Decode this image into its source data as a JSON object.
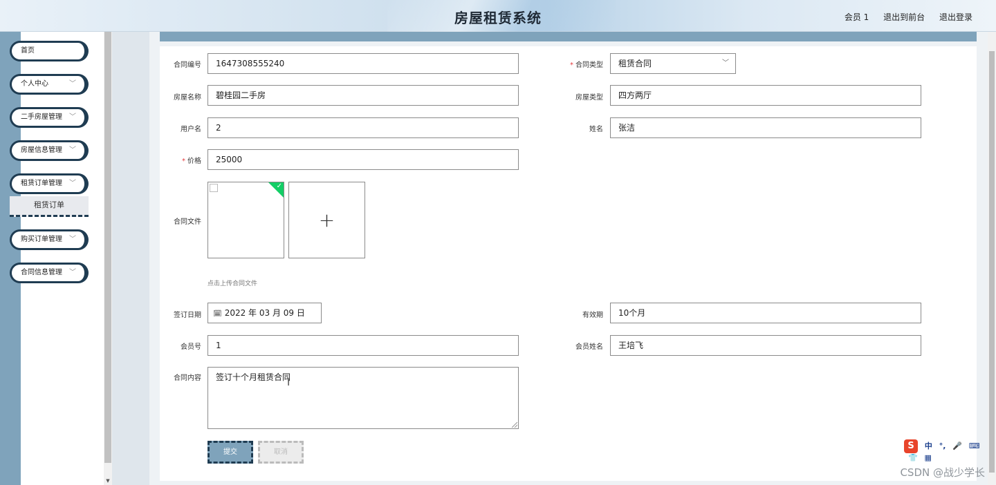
{
  "header": {
    "title": "房屋租赁系统",
    "nav": [
      "会员 1",
      "退出到前台",
      "退出登录"
    ]
  },
  "sidebar": {
    "items": [
      {
        "label": "首页",
        "has_chevron": false
      },
      {
        "label": "个人中心",
        "has_chevron": true
      },
      {
        "label": "二手房屋管理",
        "has_chevron": true
      },
      {
        "label": "房屋信息管理",
        "has_chevron": true
      },
      {
        "label": "租赁订单管理",
        "has_chevron": true
      },
      {
        "label": "购买订单管理",
        "has_chevron": true
      },
      {
        "label": "合同信息管理",
        "has_chevron": true
      }
    ],
    "submenu": {
      "label": "租赁订单"
    }
  },
  "form": {
    "contract_no": {
      "label": "合同编号",
      "value": "1647308555240"
    },
    "contract_type": {
      "label": "合同类型",
      "required": true,
      "value": "租赁合同"
    },
    "house_name": {
      "label": "房屋名称",
      "value": "碧桂园二手房"
    },
    "house_type": {
      "label": "房屋类型",
      "value": "四方两厅"
    },
    "username": {
      "label": "用户名",
      "value": "2"
    },
    "name": {
      "label": "姓名",
      "value": "张洁"
    },
    "price": {
      "label": "价格",
      "required": true,
      "value": "25000"
    },
    "contract_file": {
      "label": "合同文件",
      "hint": "点击上传合同文件",
      "add_icon": "plus-icon"
    },
    "sign_date": {
      "label": "签订日期",
      "value": "2022 年 03 月 09 日"
    },
    "validity": {
      "label": "有效期",
      "value": "10个月"
    },
    "member_no": {
      "label": "会员号",
      "value": "1"
    },
    "member_name": {
      "label": "会员姓名",
      "value": "王培飞"
    },
    "content": {
      "label": "合同内容",
      "value": "签订十个月租赁合同"
    },
    "submit_label": "提交",
    "cancel_label": "取消"
  },
  "ime": {
    "logo": "S",
    "items": [
      "中",
      "°,",
      "🎤",
      "⌨",
      "👕",
      "▦"
    ]
  },
  "watermark": "CSDN @战少学长",
  "colors": {
    "accent": "#7fa3bb",
    "dark_border": "#1f3c52",
    "required": "#e4393c",
    "success_badge": "#13ce66"
  }
}
